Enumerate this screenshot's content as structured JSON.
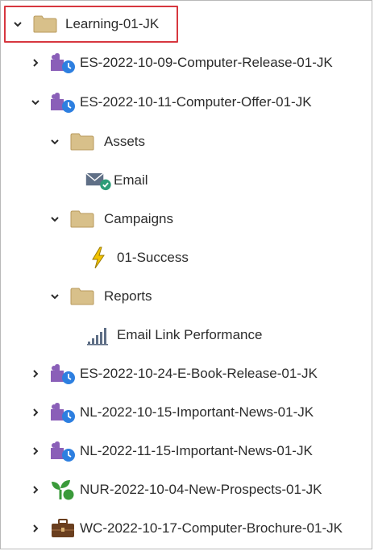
{
  "tree": {
    "root": {
      "label": "Learning-01-JK",
      "expanded": true,
      "selected": true
    },
    "items": [
      {
        "label": "ES-2022-10-09-Computer-Release-01-JK",
        "icon": "scheduled-campaign-icon",
        "expanded": false
      },
      {
        "label": "ES-2022-10-11-Computer-Offer-01-JK",
        "icon": "scheduled-campaign-icon",
        "expanded": true,
        "children": [
          {
            "label": "Assets",
            "icon": "folder-icon",
            "expanded": true,
            "children": [
              {
                "label": "Email",
                "icon": "email-approved-icon"
              }
            ]
          },
          {
            "label": "Campaigns",
            "icon": "folder-icon",
            "expanded": true,
            "children": [
              {
                "label": "01-Success",
                "icon": "trigger-campaign-icon"
              }
            ]
          },
          {
            "label": "Reports",
            "icon": "folder-icon",
            "expanded": true,
            "children": [
              {
                "label": "Email Link Performance",
                "icon": "report-icon"
              }
            ]
          }
        ]
      },
      {
        "label": "ES-2022-10-24-E-Book-Release-01-JK",
        "icon": "scheduled-campaign-icon",
        "expanded": false
      },
      {
        "label": "NL-2022-10-15-Important-News-01-JK",
        "icon": "scheduled-campaign-icon",
        "expanded": false
      },
      {
        "label": "NL-2022-11-15-Important-News-01-JK",
        "icon": "scheduled-campaign-icon",
        "expanded": false
      },
      {
        "label": "NUR-2022-10-04-New-Prospects-01-JK",
        "icon": "nurture-icon",
        "expanded": false
      },
      {
        "label": "WC-2022-10-17-Computer-Brochure-01-JK",
        "icon": "briefcase-icon",
        "expanded": false
      }
    ]
  },
  "colors": {
    "selection_border": "#d7373f",
    "folder": "#d8c08a",
    "program_purple": "#8a5fb8",
    "clock_blue": "#2d7fe0",
    "approved_green": "#2d9d78",
    "nurture_green": "#3a9a3a",
    "bolt_yellow": "#f2c300",
    "briefcase_brown": "#6a3f1f"
  }
}
